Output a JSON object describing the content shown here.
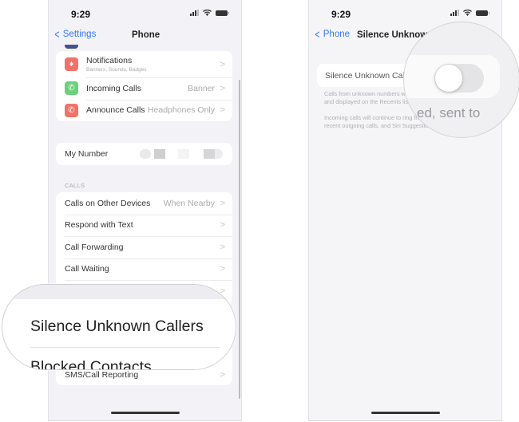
{
  "status_bar": {
    "time": "9:29"
  },
  "left_screen": {
    "back_label": "Settings",
    "title": "Phone",
    "top_group": [
      {
        "label": "Notifications",
        "sublabel": "Banners, Sounds, Badges",
        "value": "",
        "icon": "bell-icon",
        "icon_color": "#f0736a"
      },
      {
        "label": "Incoming Calls",
        "value": "Banner",
        "icon": "incoming-call-icon",
        "icon_color": "#6cd07a"
      },
      {
        "label": "Announce Calls",
        "value": "Headphones Only",
        "icon": "announce-call-icon",
        "icon_color": "#f0736a"
      }
    ],
    "my_number": {
      "label": "My Number",
      "value": "[redacted]"
    },
    "calls_section_header": "CALLS",
    "calls_group": [
      {
        "label": "Calls on Other Devices",
        "value": "When Nearby"
      },
      {
        "label": "Respond with Text",
        "value": ""
      },
      {
        "label": "Call Forwarding",
        "value": ""
      },
      {
        "label": "Call Waiting",
        "value": ""
      }
    ],
    "last_row": {
      "label": "SMS/Call Reporting"
    },
    "magnifier": {
      "primary": "Silence Unknown Callers",
      "secondary": "Blocked Contacts"
    }
  },
  "right_screen": {
    "back_label": "Phone",
    "title": "Silence Unknown Callers",
    "toggle_label": "Silence Unknown Callers",
    "toggle_on": false,
    "footnote_1": "Calls from unknown numbers will be silenced, sent to voicemail, and displayed on the Recents list.",
    "footnote_2": "Incoming calls will continue to ring from people in your contacts, recent outgoing calls, and Siri Suggestions.",
    "magnifier_caption": "ed, sent to"
  }
}
